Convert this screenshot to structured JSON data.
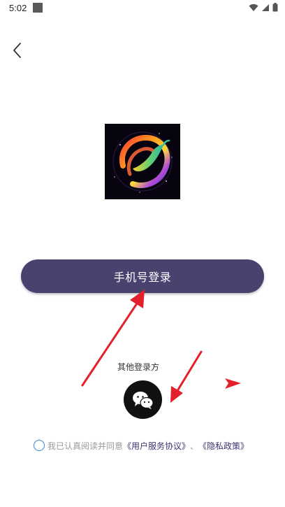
{
  "status_bar": {
    "time": "5:02",
    "icons": [
      "wifi-icon",
      "signal-icon",
      "battery-icon"
    ]
  },
  "nav": {
    "back_icon": "chevron-left-icon"
  },
  "logo": {
    "icon": "chili-pepper-swirl-logo"
  },
  "login": {
    "phone_login_label": "手机号登录"
  },
  "other_login": {
    "label": "其他登录方",
    "wechat_icon": "wechat-icon"
  },
  "agreement": {
    "prefix": "我已认真阅读并同意",
    "user_agreement": "《用户服务协议》",
    "separator": "、",
    "privacy_policy": "《隐私政策》"
  },
  "colors": {
    "primary_button": "#4b416f",
    "link": "#3b3570",
    "checkbox": "#3a86d8",
    "annotation_arrow": "#e4212a"
  }
}
